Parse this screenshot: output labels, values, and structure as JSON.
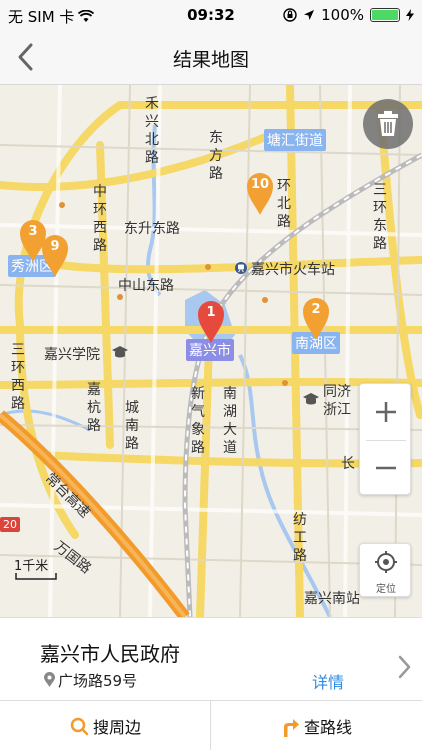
{
  "status_bar": {
    "carrier": "无 SIM 卡",
    "time": "09:32",
    "battery": "100%",
    "battery_level": 1.0
  },
  "nav": {
    "title": "结果地图",
    "back_icon": "chevron-left-icon"
  },
  "map": {
    "place_labels": {
      "tanghui": "塘汇街道",
      "xiuzhou": "秀洲区",
      "nanhu": "南湖区",
      "jiaxing_city": "嘉兴市",
      "train_station": "嘉兴市火车站",
      "jiaxing_college": "嘉兴学院",
      "tongji": "同济",
      "zhejiang": "浙江",
      "nanhu_south": "嘉兴南站",
      "chang": "长"
    },
    "roads": {
      "hexing_north": "禾兴北路",
      "dongfang": "东方路",
      "huan_north": "环北路",
      "sanhuan_east": "三环东路",
      "zhonghuan_west": "中环西路",
      "dongsheng_east": "东升东路",
      "zhongshan": "中山东路",
      "sanhuan_west": "三环西路",
      "jiahang": "嘉杭路",
      "chengnan": "城南路",
      "xinqixiang": "新气象路",
      "nanhu_avenue": "南湖大道",
      "changtai": "常台高速",
      "wanguo": "万国路",
      "fanggong": "纺工路"
    },
    "pins": [
      {
        "number": "1",
        "color": "#e64a3c"
      },
      {
        "number": "2",
        "color": "#f2a032"
      },
      {
        "number": "3",
        "color": "#f2a032"
      },
      {
        "number": "9",
        "color": "#f2a032"
      },
      {
        "number": "10",
        "color": "#f2a032"
      }
    ],
    "scale": "1千米",
    "locate_label": "定位",
    "highway_badge": "20"
  },
  "result": {
    "name": "嘉兴市人民政府",
    "address": "广场路59号",
    "detail": "详情"
  },
  "actions": {
    "search_nearby": "搜周边",
    "route": "查路线"
  },
  "colors": {
    "accent_blue": "#2d8ce6",
    "pin_orange": "#f2a032",
    "pin_red": "#e64a3c",
    "route_orange": "#f29b2b"
  }
}
